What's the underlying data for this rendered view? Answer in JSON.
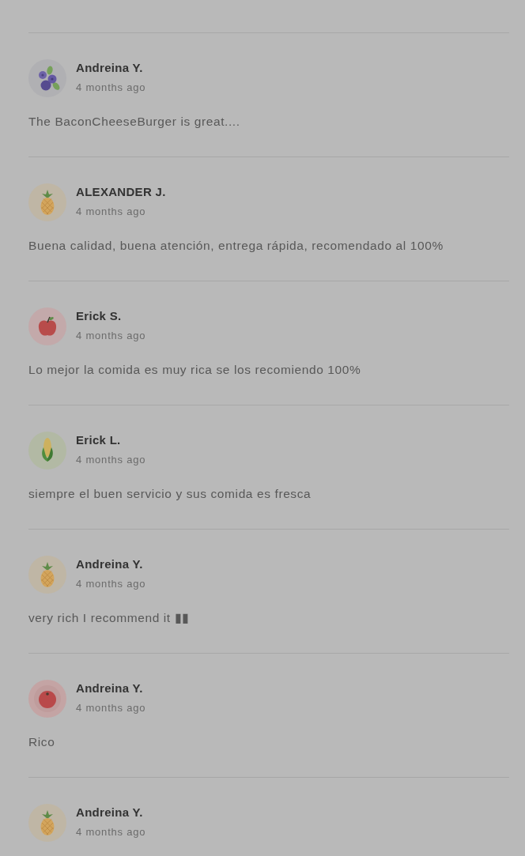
{
  "reviews": [
    {
      "author": "Andreina Y.",
      "time": "4 months ago",
      "avatar": {
        "kind": "blueberries"
      },
      "comment": "The BaconCheeseBurger is great...."
    },
    {
      "author": "ALEXANDER J.",
      "time": "4 months ago",
      "avatar": {
        "kind": "pineapple"
      },
      "comment": "Buena calidad, buena atención, entrega rápida, recomendado al 100%"
    },
    {
      "author": "Erick S.",
      "time": "4 months ago",
      "avatar": {
        "kind": "apple"
      },
      "comment": "Lo mejor la comida es muy rica se los recomiendo 100%"
    },
    {
      "author": "Erick L.",
      "time": "4 months ago",
      "avatar": {
        "kind": "corn"
      },
      "comment": "siempre el buen servicio y sus comida es fresca"
    },
    {
      "author": "Andreina Y.",
      "time": "4 months ago",
      "avatar": {
        "kind": "pineapple"
      },
      "comment": "very rich I recommend it ▮▮"
    },
    {
      "author": "Andreina Y.",
      "time": "4 months ago",
      "avatar": {
        "kind": "tomato"
      },
      "comment": "Rico"
    },
    {
      "author": "Andreina Y.",
      "time": "4 months ago",
      "avatar": {
        "kind": "pineapple"
      }
    }
  ]
}
